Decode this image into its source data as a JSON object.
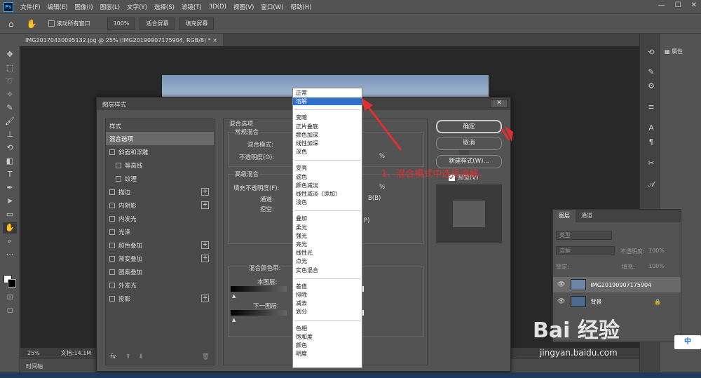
{
  "menubar": {
    "items": [
      "文件(F)",
      "编辑(E)",
      "图像(I)",
      "图层(L)",
      "文字(Y)",
      "选择(S)",
      "滤镜(T)",
      "3D(D)",
      "视图(V)",
      "窗口(W)",
      "帮助(H)"
    ]
  },
  "optbar": {
    "scroll_all": "滚动所有窗口",
    "zoom": "100%",
    "fit_screen": "适合屏幕",
    "fill_screen": "填充屏幕"
  },
  "doc_tab": "IMG20170430095132.jpg @ 25% (IMG20190907175904, RGB/8) * ×",
  "status": {
    "zoom": "25%",
    "doc": "文档:14.1M"
  },
  "timeline": "时间轴",
  "right": {
    "properties": "属性"
  },
  "layers_panel": {
    "tabs": [
      "图层",
      "通道"
    ],
    "kind": "类型",
    "blend": "溶解",
    "opacity_label": "不透明度:",
    "opacity_value": "100%",
    "lock_label": "锁定:",
    "fill_label": "填充:",
    "fill_value": "100%",
    "layers": [
      "IMG20190907175904",
      "背景"
    ]
  },
  "dialog": {
    "title": "图层样式",
    "close": "✕",
    "styles_header": "样式",
    "styles": [
      {
        "label": "混合选项",
        "sel": true,
        "box": false,
        "plus": false
      },
      {
        "label": "斜面和浮雕",
        "box": true,
        "plus": false
      },
      {
        "label": "等高线",
        "box": true,
        "plus": false,
        "indent": true
      },
      {
        "label": "纹理",
        "box": true,
        "plus": false,
        "indent": true
      },
      {
        "label": "描边",
        "box": true,
        "plus": true
      },
      {
        "label": "内阴影",
        "box": true,
        "plus": true
      },
      {
        "label": "内发光",
        "box": true,
        "plus": false
      },
      {
        "label": "光泽",
        "box": true,
        "plus": false
      },
      {
        "label": "颜色叠加",
        "box": true,
        "plus": true
      },
      {
        "label": "渐变叠加",
        "box": true,
        "plus": true
      },
      {
        "label": "图案叠加",
        "box": true,
        "plus": false
      },
      {
        "label": "外发光",
        "box": true,
        "plus": false
      },
      {
        "label": "投影",
        "box": true,
        "plus": true
      }
    ],
    "fx": "fx",
    "blend_options": "混合选项",
    "general_blend": "常规混合",
    "blend_mode_label": "混合模式:",
    "opacity_label": "不透明度(O):",
    "percent": "%",
    "advanced_blend": "高级混合",
    "fill_opacity_label": "填充不透明度(F):",
    "channels_label": "通道:",
    "knockout_label": "挖空:",
    "channel_b": "B(B)",
    "p_text": "P)",
    "blend_if": "混合颜色带:",
    "this_layer": "本图层:",
    "under_layer": "下一图层:",
    "ok": "确定",
    "cancel": "取消",
    "new_style": "新建样式(W)...",
    "preview": "预览(V)"
  },
  "dropdown": {
    "groups": [
      [
        "正常",
        "溶解"
      ],
      [
        "变暗",
        "正片叠底",
        "颜色加深",
        "线性加深",
        "深色"
      ],
      [
        "变亮",
        "滤色",
        "颜色减淡",
        "线性减淡（添加）",
        "浅色"
      ],
      [
        "叠加",
        "柔光",
        "强光",
        "亮光",
        "线性光",
        "点光",
        "实色混合"
      ],
      [
        "差值",
        "排除",
        "减去",
        "划分"
      ],
      [
        "色相",
        "饱和度",
        "颜色",
        "明度"
      ]
    ],
    "highlighted": "溶解"
  },
  "annotation": "1、混合模式中选择溶解，",
  "watermark": {
    "logo": "Bai 经验",
    "url": "jingyan.baidu.com"
  },
  "ime": "中",
  "colors": {
    "annotation_red": "#e03030",
    "highlight_blue": "#2f6fc9"
  }
}
